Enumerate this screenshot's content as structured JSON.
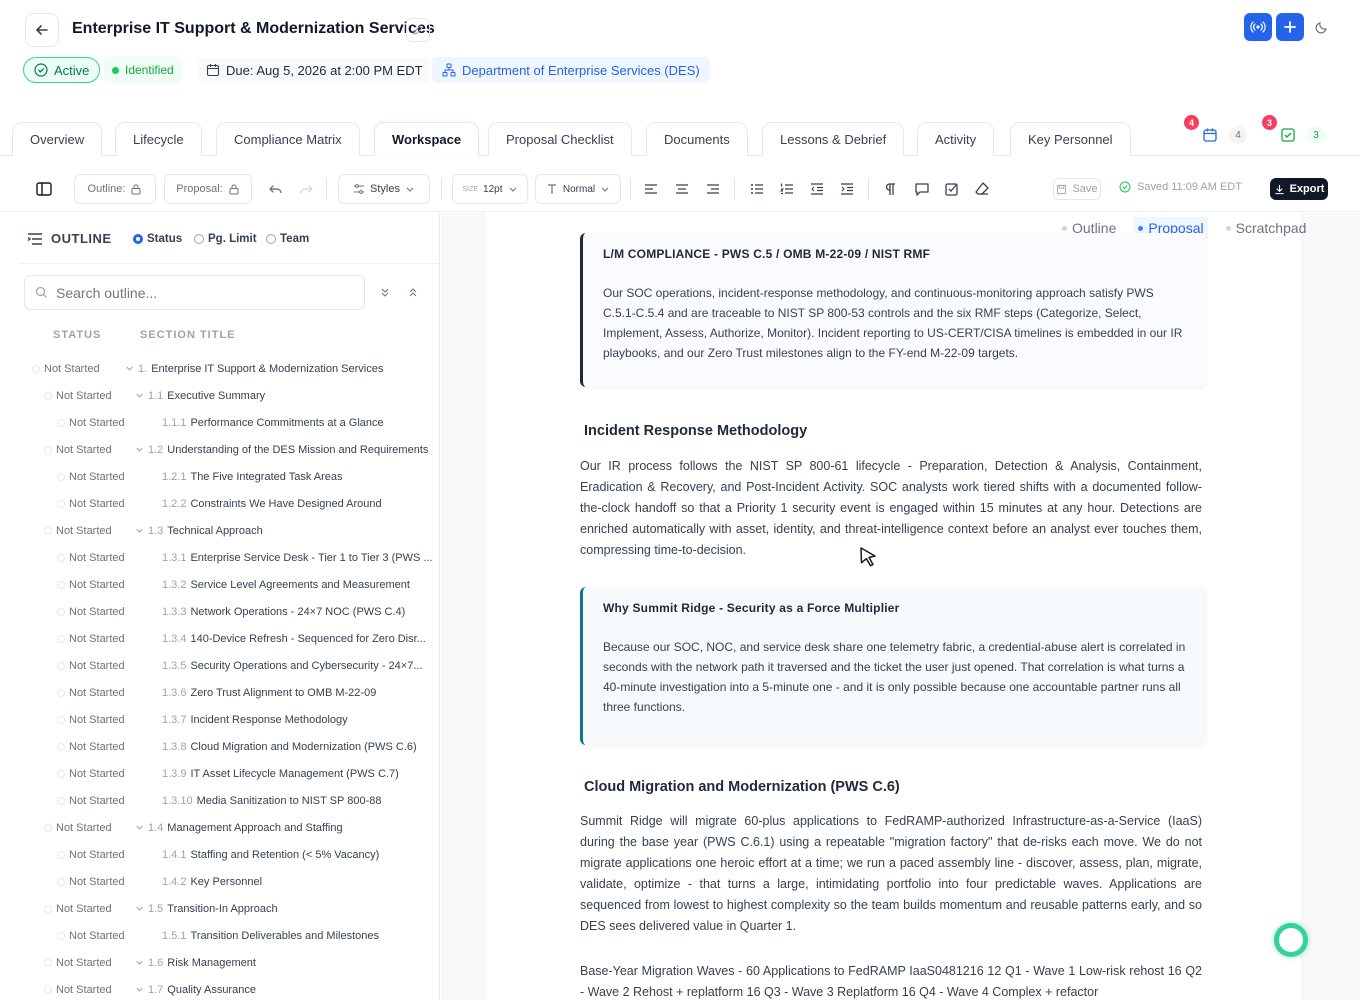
{
  "header": {
    "title": "Enterprise IT Support & Modernization Services",
    "chips": {
      "active": "Active",
      "identified": "Identified",
      "due": "Due: Aug 5, 2026 at 2:00 PM EDT",
      "department": "Department of Enterprise Services (DES)"
    },
    "accent": "#2563eb"
  },
  "tabs": [
    {
      "label": "Overview"
    },
    {
      "label": "Lifecycle"
    },
    {
      "label": "Compliance Matrix"
    },
    {
      "label": "Workspace"
    },
    {
      "label": "Proposal Checklist"
    },
    {
      "label": "Documents"
    },
    {
      "label": "Lessons & Debrief"
    },
    {
      "label": "Activity"
    },
    {
      "label": "Key Personnel"
    }
  ],
  "tab_badges": {
    "calendar_badge": "4",
    "calendar_count": "4",
    "tasks_badge": "3",
    "tasks_count": "3"
  },
  "toolbar": {
    "outline_label": "Outline:",
    "proposal_label": "Proposal:",
    "styles_label": "Styles",
    "size_prefix": "SIZE",
    "size_value": "12pt",
    "paragraph_style": "Normal",
    "save_label": "Save",
    "saved_status": "Saved 11:09 AM EDT",
    "export_label": "Export"
  },
  "outline": {
    "heading": "OUTLINE",
    "modes": [
      "Status",
      "Pg. Limit",
      "Team"
    ],
    "search_placeholder": "Search outline...",
    "col_status": "STATUS",
    "col_title": "SECTION TITLE",
    "rows": [
      {
        "status": "Not Started",
        "num": "1.",
        "title": "Enterprise IT Support & Modernization Services"
      },
      {
        "status": "Not Started",
        "num": "1.1",
        "title": "Executive Summary"
      },
      {
        "status": "Not Started",
        "num": "1.1.1",
        "title": "Performance Commitments at a Glance"
      },
      {
        "status": "Not Started",
        "num": "1.2",
        "title": "Understanding of the DES Mission and Requirements"
      },
      {
        "status": "Not Started",
        "num": "1.2.1",
        "title": "The Five Integrated Task Areas"
      },
      {
        "status": "Not Started",
        "num": "1.2.2",
        "title": "Constraints We Have Designed Around"
      },
      {
        "status": "Not Started",
        "num": "1.3",
        "title": "Technical Approach"
      },
      {
        "status": "Not Started",
        "num": "1.3.1",
        "title": "Enterprise Service Desk - Tier 1 to Tier 3 (PWS ..."
      },
      {
        "status": "Not Started",
        "num": "1.3.2",
        "title": "Service Level Agreements and Measurement"
      },
      {
        "status": "Not Started",
        "num": "1.3.3",
        "title": "Network Operations - 24×7 NOC (PWS C.4)"
      },
      {
        "status": "Not Started",
        "num": "1.3.4",
        "title": "140-Device Refresh - Sequenced for Zero Disr..."
      },
      {
        "status": "Not Started",
        "num": "1.3.5",
        "title": "Security Operations and Cybersecurity - 24×7..."
      },
      {
        "status": "Not Started",
        "num": "1.3.6",
        "title": "Zero Trust Alignment to OMB M-22-09"
      },
      {
        "status": "Not Started",
        "num": "1.3.7",
        "title": "Incident Response Methodology"
      },
      {
        "status": "Not Started",
        "num": "1.3.8",
        "title": "Cloud Migration and Modernization (PWS C.6)"
      },
      {
        "status": "Not Started",
        "num": "1.3.9",
        "title": "IT Asset Lifecycle Management (PWS C.7)"
      },
      {
        "status": "Not Started",
        "num": "1.3.10",
        "title": "Media Sanitization to NIST SP 800-88"
      },
      {
        "status": "Not Started",
        "num": "1.4",
        "title": "Management Approach and Staffing"
      },
      {
        "status": "Not Started",
        "num": "1.4.1",
        "title": "Staffing and Retention (< 5% Vacancy)"
      },
      {
        "status": "Not Started",
        "num": "1.4.2",
        "title": "Key Personnel"
      },
      {
        "status": "Not Started",
        "num": "1.5",
        "title": "Transition-In Approach"
      },
      {
        "status": "Not Started",
        "num": "1.5.1",
        "title": "Transition Deliverables and Milestones"
      },
      {
        "status": "Not Started",
        "num": "1.6",
        "title": "Risk Management"
      },
      {
        "status": "Not Started",
        "num": "1.7",
        "title": "Quality Assurance"
      }
    ]
  },
  "document": {
    "view_tabs": [
      "Outline",
      "Proposal",
      "Scratchpad"
    ],
    "callout1": {
      "title": "L/M COMPLIANCE - PWS C.5 / OMB M-22-09 / NIST RMF",
      "body": "Our SOC operations, incident-response methodology, and continuous-monitoring approach satisfy PWS C.5.1-C.5.4 and are traceable to NIST SP 800-53 controls and the six RMF steps (Categorize, Select, Implement, Assess, Authorize, Monitor). Incident reporting to US-CERT/CISA timelines is embedded in our IR playbooks, and our Zero Trust milestones align to the FY-end M-22-09 targets."
    },
    "heading1": "Incident Response Methodology",
    "para1": "Our IR process follows the NIST SP 800-61 lifecycle - Preparation, Detection & Analysis, Containment, Eradication & Recovery, and Post-Incident Activity. SOC analysts work tiered shifts with a documented follow-the-clock handoff so that a Priority 1 security event is engaged within 15 minutes at any hour. Detections are enriched automatically with asset, identity, and threat-intelligence context before an analyst ever touches them, compressing time-to-decision.",
    "callout2": {
      "title": "Why Summit Ridge - Security as a Force Multiplier",
      "body": "Because our SOC, NOC, and service desk share one telemetry fabric, a credential-abuse alert is correlated in seconds with the network path it traversed and the ticket the user just opened. That correlation is what turns a 40-minute investigation into a 5-minute one - and it is only possible because one accountable partner runs all three functions."
    },
    "heading2": "Cloud Migration and Modernization (PWS C.6)",
    "para2": "Summit Ridge will migrate 60-plus applications to FedRAMP-authorized Infrastructure-as-a-Service (IaaS) during the base year (PWS C.6.1) using a repeatable \"migration factory\" that de-risks each move. We do not migrate applications one heroic effort at a time; we run a paced assembly line - discover, assess, plan, migrate, validate, optimize - that turns a large, intimidating portfolio into four predictable waves. Applications are sequenced from lowest to highest complexity so the team builds momentum and reusable patterns early, and so DES sees delivered value in Quarter 1.",
    "para3": "Base-Year Migration Waves - 60 Applications to FedRAMP IaaS0481216 12 Q1 - Wave 1 Low-risk rehost 16 Q2 - Wave 2 Rehost + replatform 16 Q3 - Wave 3 Replatform 16 Q4 - Wave 4 Complex + refactor"
  }
}
